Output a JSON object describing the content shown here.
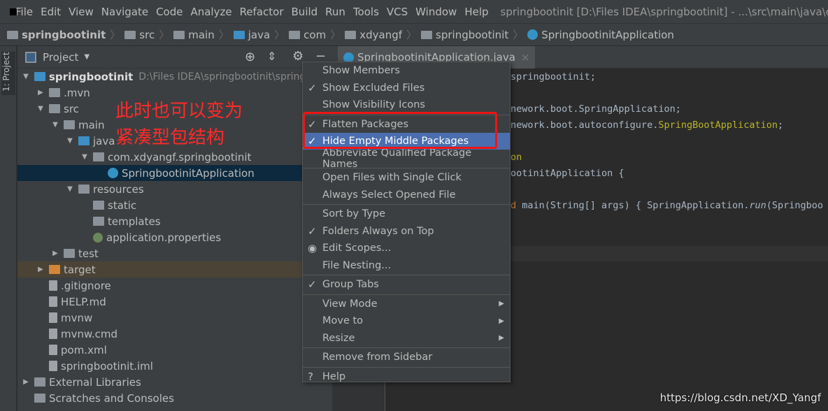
{
  "menubar": {
    "items": [
      "File",
      "Edit",
      "View",
      "Navigate",
      "Code",
      "Analyze",
      "Refactor",
      "Build",
      "Run",
      "Tools",
      "VCS",
      "Window",
      "Help"
    ],
    "title": "springbootinit [D:\\Files IDEA\\springbootinit] - ...\\src\\main\\java\\com\\x"
  },
  "breadcrumb": [
    "springbootinit",
    "src",
    "main",
    "java",
    "com",
    "xdyangf",
    "springbootinit",
    "SpringbootinitApplication"
  ],
  "stripe": {
    "label": "1: Project"
  },
  "project": {
    "title": "Project"
  },
  "tree": [
    {
      "label": "springbootinit",
      "extra": "D:\\Files IDEA\\springbootinit\\springboo",
      "indent": 0,
      "arrow": "▼",
      "icon": "module-folder-icon",
      "cls": "blue"
    },
    {
      "label": ".mvn",
      "indent": 1,
      "arrow": "▶",
      "icon": "folder-icon",
      "cls": ""
    },
    {
      "label": "src",
      "indent": 1,
      "arrow": "▼",
      "icon": "folder-icon",
      "cls": ""
    },
    {
      "label": "main",
      "indent": 2,
      "arrow": "▼",
      "icon": "folder-icon",
      "cls": ""
    },
    {
      "label": "java",
      "indent": 3,
      "arrow": "▼",
      "icon": "source-folder-icon",
      "cls": "blue"
    },
    {
      "label": "com.xdyangf.springbootinit",
      "indent": 4,
      "arrow": "▼",
      "icon": "package-icon",
      "cls": ""
    },
    {
      "label": "SpringbootinitApplication",
      "indent": 5,
      "arrow": "",
      "icon": "spring-class-icon",
      "cls": "cls"
    },
    {
      "label": "resources",
      "indent": 3,
      "arrow": "▼",
      "icon": "resources-folder-icon",
      "cls": ""
    },
    {
      "label": "static",
      "indent": 4,
      "arrow": "",
      "icon": "folder-icon",
      "cls": ""
    },
    {
      "label": "templates",
      "indent": 4,
      "arrow": "",
      "icon": "folder-icon",
      "cls": ""
    },
    {
      "label": "application.properties",
      "indent": 4,
      "arrow": "",
      "icon": "spring-properties-icon",
      "cls": "spring"
    },
    {
      "label": "test",
      "indent": 2,
      "arrow": "▶",
      "icon": "folder-icon",
      "cls": ""
    },
    {
      "label": "target",
      "indent": 1,
      "arrow": "▶",
      "icon": "excluded-folder-icon",
      "cls": "orange"
    },
    {
      "label": ".gitignore",
      "indent": 1,
      "arrow": "",
      "icon": "file-icon",
      "cls": "file"
    },
    {
      "label": "HELP.md",
      "indent": 1,
      "arrow": "",
      "icon": "markdown-icon",
      "cls": "file"
    },
    {
      "label": "mvnw",
      "indent": 1,
      "arrow": "",
      "icon": "file-icon",
      "cls": "file"
    },
    {
      "label": "mvnw.cmd",
      "indent": 1,
      "arrow": "",
      "icon": "file-icon",
      "cls": "file"
    },
    {
      "label": "pom.xml",
      "indent": 1,
      "arrow": "",
      "icon": "maven-icon",
      "cls": "file"
    },
    {
      "label": "springbootinit.iml",
      "indent": 1,
      "arrow": "",
      "icon": "file-icon",
      "cls": "file"
    },
    {
      "label": "External Libraries",
      "indent": 0,
      "arrow": "▶",
      "icon": "library-icon",
      "cls": ""
    },
    {
      "label": "Scratches and Consoles",
      "indent": 0,
      "arrow": "",
      "icon": "scratches-icon",
      "cls": ""
    }
  ],
  "annotation": [
    "此时也可以变为",
    "紧凑型包结构"
  ],
  "editor": {
    "tab": "SpringbootinitApplication.java",
    "lines": [
      {
        "parts": [
          [
            "",
            "springbootinit;"
          ]
        ]
      },
      {
        "parts": [
          [
            "",
            "nework.boot.SpringApplication;"
          ]
        ]
      },
      {
        "parts": [
          [
            "",
            "nework.boot.autoconfigure."
          ],
          [
            "an",
            "SpringBootApplication"
          ],
          [
            "",
            ";"
          ]
        ]
      },
      {
        "parts": [
          [
            "an",
            "on"
          ]
        ]
      },
      {
        "parts": [
          [
            "",
            "ootinitApplication {"
          ]
        ]
      },
      {
        "parts": [
          [
            "kw",
            "d "
          ],
          [
            "",
            "main(String[] args) { SpringApplication."
          ],
          [
            "it",
            "run"
          ],
          [
            "",
            "(Springboo"
          ]
        ]
      }
    ]
  },
  "menu": [
    {
      "label": "Show Members",
      "mark": ""
    },
    {
      "label": "Show Excluded Files",
      "mark": "✓"
    },
    {
      "label": "Show Visibility Icons",
      "mark": "",
      "sep": true
    },
    {
      "label": "Flatten Packages",
      "mark": "✓"
    },
    {
      "label": "Hide Empty Middle Packages",
      "mark": "✓",
      "highlighted": true
    },
    {
      "label": "Abbreviate Qualified Package Names",
      "mark": "",
      "sep": true
    },
    {
      "label": "Open Files with Single Click",
      "mark": ""
    },
    {
      "label": "Always Select Opened File",
      "mark": "",
      "sep": true
    },
    {
      "label": "Sort by Type",
      "mark": ""
    },
    {
      "label": "Folders Always on Top",
      "mark": "✓"
    },
    {
      "label": "Edit Scopes...",
      "mark": "◉"
    },
    {
      "label": "File Nesting...",
      "mark": "",
      "sep": true
    },
    {
      "label": "Group Tabs",
      "mark": "✓",
      "sep": true
    },
    {
      "label": "View Mode",
      "mark": "",
      "submenu": true
    },
    {
      "label": "Move to",
      "mark": "",
      "submenu": true
    },
    {
      "label": "Resize",
      "mark": "",
      "submenu": true,
      "sep": true
    },
    {
      "label": "Remove from Sidebar",
      "mark": "",
      "sep": true
    },
    {
      "label": "Help",
      "mark": "?"
    }
  ],
  "watermark": "https://blog.csdn.net/XD_Yangf"
}
